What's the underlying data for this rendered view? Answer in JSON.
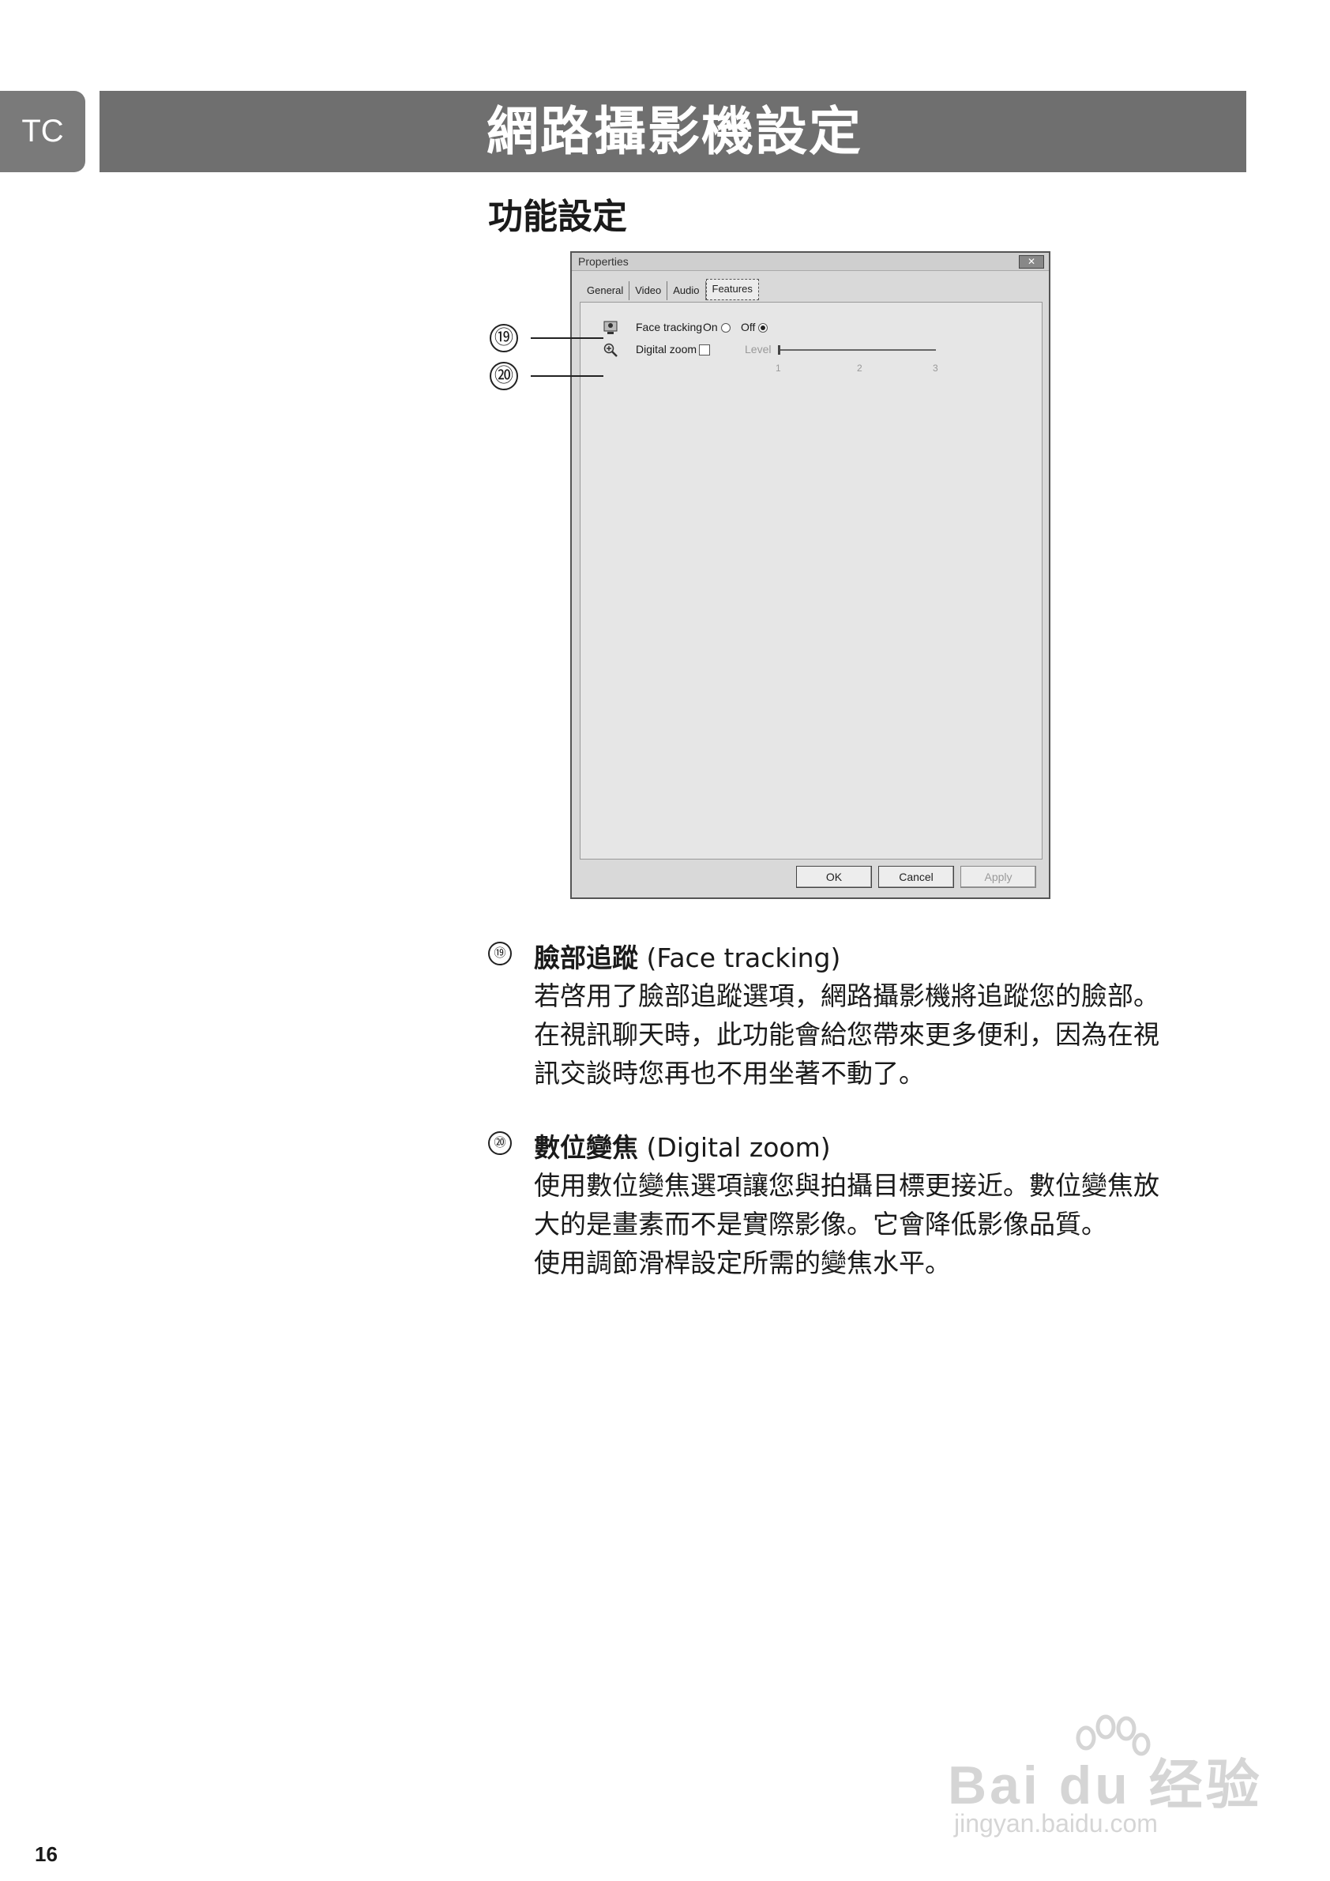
{
  "lang_tab": "TC",
  "header": {
    "title": "網路攝影機設定"
  },
  "section_title": "功能設定",
  "dialog": {
    "title": "Properties",
    "close_label": "✕",
    "tabs": [
      "General",
      "Video",
      "Audio",
      "Features"
    ],
    "face_tracking": {
      "label": "Face tracking",
      "on_label": "On",
      "off_label": "Off",
      "selected": "Off"
    },
    "digital_zoom": {
      "label": "Digital zoom",
      "checked": false,
      "level_label": "Level",
      "ticks": [
        "1",
        "2",
        "3"
      ]
    },
    "buttons": {
      "ok": "OK",
      "cancel": "Cancel",
      "apply": "Apply"
    }
  },
  "callouts": [
    "⑲",
    "⑳"
  ],
  "items": [
    {
      "num": "⑲",
      "title_zh": "臉部追蹤",
      "title_en": "(Face tracking)",
      "lines": [
        "若啓用了臉部追蹤選項，網路攝影機將追蹤您的臉部。",
        "在視訊聊天時，此功能會給您帶來更多便利，因為在視",
        "訊交談時您再也不用坐著不動了。"
      ]
    },
    {
      "num": "⑳",
      "title_zh": "數位變焦",
      "title_en": "(Digital zoom)",
      "lines": [
        "使用數位變焦選項讓您與拍攝目標更接近。數位變焦放",
        "大的是畫素而不是實際影像。它會降低影像品質。",
        "使用調節滑桿設定所需的變焦水平。"
      ]
    }
  ],
  "page_number": "16",
  "watermark": {
    "main": "Bai du 经验",
    "sub": "jingyan.baidu.com"
  }
}
